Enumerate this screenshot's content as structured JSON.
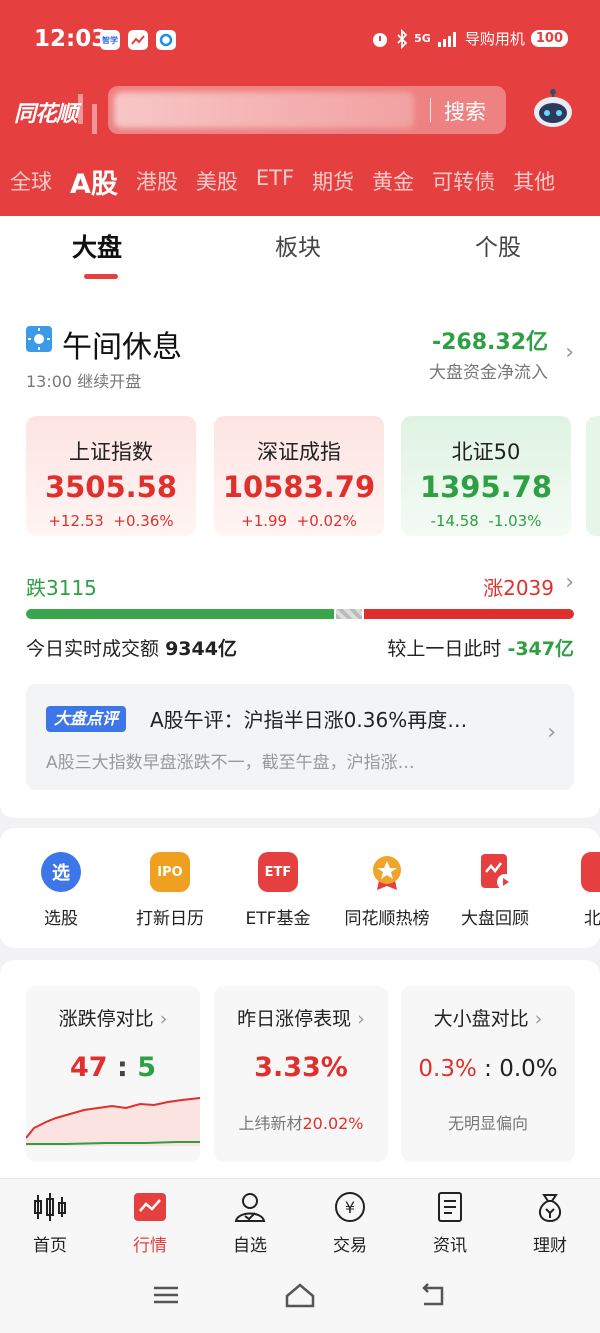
{
  "status": {
    "time": "12:03",
    "network": "5G",
    "carrier": "导购用机",
    "battery": "100",
    "apps": [
      "智学",
      "",
      ""
    ]
  },
  "header": {
    "logo": "同花顺",
    "search_button": "搜索",
    "market_tabs": [
      "全球",
      "A股",
      "港股",
      "美股",
      "ETF",
      "期货",
      "黄金",
      "可转债",
      "其他"
    ],
    "active_market": "A股"
  },
  "sub_tabs": [
    "大盘",
    "板块",
    "个股"
  ],
  "session": {
    "title": "午间休息",
    "subtitle": "13:00 继续开盘",
    "net_flow": "-268.32亿",
    "net_flow_label": "大盘资金净流入"
  },
  "indices": [
    {
      "name": "上证指数",
      "price": "3505.58",
      "change": "+12.53",
      "pct": "+0.36%",
      "trend": "up"
    },
    {
      "name": "深证成指",
      "price": "10583.79",
      "change": "+1.99",
      "pct": "+0.02%",
      "trend": "up"
    },
    {
      "name": "北证50",
      "price": "1395.78",
      "change": "-14.58",
      "pct": "-1.03%",
      "trend": "down"
    }
  ],
  "breadth": {
    "fall_label": "跌3115",
    "rise_label": "涨2039",
    "fall": 3115,
    "rise": 2039
  },
  "volume": {
    "label": "今日实时成交额",
    "value": "9344亿",
    "compare_label": "较上一日此时",
    "compare_value": "-347亿"
  },
  "news": {
    "badge": "大盘点评",
    "title": "A股午评：沪指半日涨0.36%再度…",
    "summary": "A股三大指数早盘涨跌不一，截至午盘，沪指涨…"
  },
  "tools": [
    {
      "label": "选股",
      "icon": "选"
    },
    {
      "label": "打新日历",
      "icon": "IPO"
    },
    {
      "label": "ETF基金",
      "icon": "ETF"
    },
    {
      "label": "同花顺热榜",
      "icon": ""
    },
    {
      "label": "大盘回顾",
      "icon": ""
    },
    {
      "label": "北交",
      "icon": ""
    }
  ],
  "stats": [
    {
      "title": "涨跌停对比",
      "value_left": "47",
      "value_sep": ":",
      "value_right": "5"
    },
    {
      "title": "昨日涨停表现",
      "value": "3.33%",
      "foot_name": "上纬新材",
      "foot_value": "20.02%"
    },
    {
      "title": "大小盘对比",
      "value_left": "0.3%",
      "value_sep": ":",
      "value_right": "0.0%",
      "foot": "无明显偏向"
    }
  ],
  "bottom_nav": [
    "首页",
    "行情",
    "自选",
    "交易",
    "资讯",
    "理财"
  ],
  "active_nav": "行情",
  "colors": {
    "brand_red": "#e5403f",
    "up_red": "#e0302d",
    "down_green": "#2ea043",
    "badge_blue": "#3c76e8"
  }
}
